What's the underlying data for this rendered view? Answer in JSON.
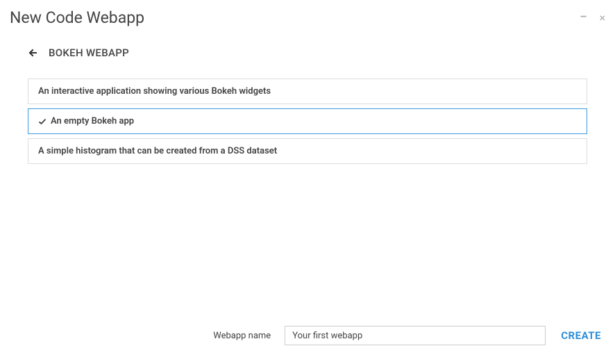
{
  "header": {
    "title": "New Code Webapp"
  },
  "subheader": {
    "title": "BOKEH WEBAPP"
  },
  "options": [
    {
      "label": "An interactive application showing various Bokeh widgets",
      "selected": false
    },
    {
      "label": "An empty Bokeh app",
      "selected": true
    },
    {
      "label": "A simple histogram that can be created from a DSS dataset",
      "selected": false
    }
  ],
  "footer": {
    "label": "Webapp name",
    "input_value": "Your first webapp",
    "create_label": "CREATE"
  }
}
